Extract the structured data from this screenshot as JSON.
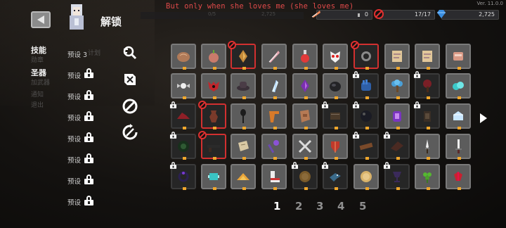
{
  "top": {
    "song": "But only when she loves me (she loves me)",
    "version": "Ver. 11.0.0",
    "faint_left": "0/5",
    "faint_mid": "2,725",
    "res_feather": "0",
    "res_ban": "17/17",
    "res_gem": "2,725"
  },
  "title": "解锁",
  "categories": [
    "技能",
    "圣器"
  ],
  "ghost_labels": [
    "勋章",
    "加武器",
    "计划",
    "通知",
    "退出"
  ],
  "presets": [
    "预设 3",
    "预设",
    "预设",
    "预设",
    "预设",
    "预设",
    "预设",
    "预设"
  ],
  "tools": [
    "search-filter-icon",
    "sort-icon",
    "ban-all-icon",
    "reset-icon"
  ],
  "grid": [
    [
      {
        "i": "bread",
        "s": "n"
      },
      {
        "i": "onion",
        "s": "n"
      },
      {
        "i": "amber",
        "s": "sel"
      },
      {
        "i": "feather",
        "s": "n"
      },
      {
        "i": "potion-red",
        "s": "n"
      },
      {
        "i": "mask",
        "s": "n"
      },
      {
        "i": "skull-ring",
        "s": "sel"
      },
      {
        "i": "scroll",
        "s": "n"
      },
      {
        "i": "scroll",
        "s": "n"
      },
      {
        "i": "meat",
        "s": "n"
      }
    ],
    [
      {
        "i": "candy",
        "s": "n"
      },
      {
        "i": "red-demon",
        "s": "n"
      },
      {
        "i": "hat",
        "s": "n"
      },
      {
        "i": "crystal",
        "s": "n"
      },
      {
        "i": "purple-gem",
        "s": "n"
      },
      {
        "i": "stone",
        "s": "n"
      },
      {
        "i": "blue-gauntlet",
        "s": "lock"
      },
      {
        "i": "blue-tree",
        "s": "n"
      },
      {
        "i": "red-tree",
        "s": "lock"
      },
      {
        "i": "cyan-coins",
        "s": "n"
      }
    ],
    [
      {
        "i": "red-hat",
        "s": "lock"
      },
      {
        "i": "vase",
        "s": "sel"
      },
      {
        "i": "spoon",
        "s": "n"
      },
      {
        "i": "orange-boomerang",
        "s": "n"
      },
      {
        "i": "leather",
        "s": "n"
      },
      {
        "i": "book",
        "s": "lock"
      },
      {
        "i": "dark-orb",
        "s": "lock"
      },
      {
        "i": "purple-lantern",
        "s": "n"
      },
      {
        "i": "lantern",
        "s": "lock"
      },
      {
        "i": "ice-cube",
        "s": "n"
      }
    ],
    [
      {
        "i": "green-orb",
        "s": "lock"
      },
      {
        "i": "gun",
        "s": "sel"
      },
      {
        "i": "paper",
        "s": "n"
      },
      {
        "i": "staff",
        "s": "n"
      },
      {
        "i": "crossed-swords",
        "s": "n"
      },
      {
        "i": "red-shield",
        "s": "n"
      },
      {
        "i": "plank",
        "s": "lock"
      },
      {
        "i": "wing",
        "s": "lock"
      },
      {
        "i": "dagger",
        "s": "n"
      },
      {
        "i": "sword",
        "s": "n"
      }
    ],
    [
      {
        "i": "purple-ring",
        "s": "lock"
      },
      {
        "i": "cyan-gadget",
        "s": "n"
      },
      {
        "i": "golden-pile",
        "s": "n"
      },
      {
        "i": "boot",
        "s": "n"
      },
      {
        "i": "bronze-coin",
        "s": "lock"
      },
      {
        "i": "bird",
        "s": "lock"
      },
      {
        "i": "gold-coin",
        "s": "n"
      },
      {
        "i": "purple-chalice",
        "s": "lock"
      },
      {
        "i": "green-clover",
        "s": "n"
      },
      {
        "i": "red-gem",
        "s": "n"
      }
    ]
  ],
  "pages": [
    "1",
    "2",
    "3",
    "4",
    "5"
  ],
  "active_page": "1",
  "colors": {
    "accent_red": "#d23030",
    "rarity_dot": "#f0a72c",
    "cell": "#5c5c5c"
  }
}
